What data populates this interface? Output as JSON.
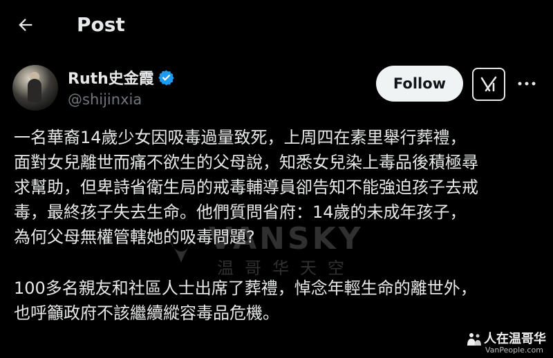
{
  "header": {
    "back_icon": "arrow-left-icon",
    "title": "Post"
  },
  "author": {
    "display_name": "Ruth史金霞",
    "verified_icon": "verified-badge-icon",
    "verified_color": "#1d9bf0",
    "handle": "@shijinxia"
  },
  "actions": {
    "follow_label": "Follow",
    "grok_icon": "grok-icon",
    "more_icon": "more-horizontal-icon"
  },
  "post": {
    "paragraph1_lines": [
      "一名華裔14歲少女因吸毒過量致死，上周四在素里舉行葬禮，",
      "面對女兒離世而痛不欲生的父母說，知悉女兒染上毒品後積極尋",
      "求幫助，但卑詩省衛生局的戒毒輔導員卻告知不能強迫孩子去戒",
      "毒，最終孩子失去生命。他們質問省府：14歲的未成年孩子，",
      "為何父母無權管轄她的吸毒問題?"
    ],
    "paragraph2_lines": [
      "100多名親友和社區人士出席了葬禮，悼念年輕生命的離世外，",
      "也呼籲政府不該繼續縱容毒品危機。"
    ]
  },
  "watermark": {
    "brand": "VANSKY",
    "subtitle": "温哥华天空"
  },
  "corner_logo": {
    "title": "人在温哥华",
    "url": "VanPeople.com"
  },
  "colors": {
    "background": "#000000",
    "text_primary": "#e7e9ea",
    "text_secondary": "#71767b",
    "follow_bg": "#eff3f4"
  }
}
